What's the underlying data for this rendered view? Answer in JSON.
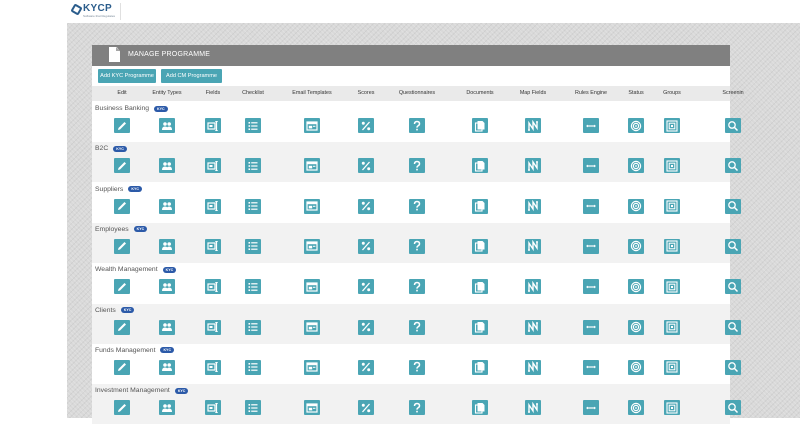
{
  "app": {
    "logo_text": "KYCP",
    "logo_subtitle": "Software that Regulates"
  },
  "panel": {
    "title": "MANAGE PROGRAMME"
  },
  "buttons": {
    "add_kyc": "Add KYC Programme",
    "add_cm": "Add CM Programme"
  },
  "columns": [
    {
      "label": "Edit",
      "icon": "edit-icon"
    },
    {
      "label": "Entity Types",
      "icon": "people-icon"
    },
    {
      "label": "Fields",
      "icon": "fields-icon"
    },
    {
      "label": "Checklist",
      "icon": "checklist-icon"
    },
    {
      "label": "Email Templates",
      "icon": "email-template-icon"
    },
    {
      "label": "Scores",
      "icon": "percent-icon"
    },
    {
      "label": "Questionnaires",
      "icon": "question-icon"
    },
    {
      "label": "Documents",
      "icon": "documents-icon"
    },
    {
      "label": "Map Fields",
      "icon": "map-fields-icon"
    },
    {
      "label": "Rules Engine",
      "icon": "rules-engine-icon"
    },
    {
      "label": "Status",
      "icon": "status-icon"
    },
    {
      "label": "Groups",
      "icon": "groups-icon"
    },
    {
      "label": "Screenin",
      "icon": "screening-icon"
    }
  ],
  "programmes": [
    {
      "name": "Business Banking",
      "badge": "KYC"
    },
    {
      "name": "B2C",
      "badge": "KYC"
    },
    {
      "name": "Suppliers",
      "badge": "KYC"
    },
    {
      "name": "Employees",
      "badge": "KYC"
    },
    {
      "name": "Wealth Management",
      "badge": "KYC"
    },
    {
      "name": "Clients",
      "badge": "KYC"
    },
    {
      "name": "Funds Management",
      "badge": "KYC"
    },
    {
      "name": "Investment Management",
      "badge": "KYC"
    }
  ]
}
